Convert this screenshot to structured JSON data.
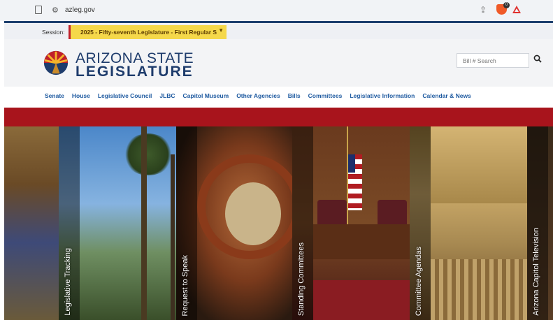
{
  "browser": {
    "url": "azleg.gov",
    "icons": [
      "bookmark-icon",
      "site-settings-icon",
      "share-icon",
      "brave-shield-icon",
      "rewards-icon"
    ],
    "shield_badge": "0"
  },
  "session": {
    "label": "Session:",
    "selected": "2025 - Fifty-seventh Legislature - First Regular S"
  },
  "header": {
    "title_line1": "ARIZONA STATE",
    "title_line2": "LEGISLATURE",
    "search_placeholder": "Bill # Search"
  },
  "nav": {
    "items": [
      "Senate",
      "House",
      "Legislative Council",
      "JLBC",
      "Capitol Museum",
      "Other Agencies",
      "Bills",
      "Committees",
      "Legislative Information",
      "Calendar & News"
    ]
  },
  "tiles": [
    {
      "label": ""
    },
    {
      "label": "Legislative Tracking"
    },
    {
      "label": "Request to Speak"
    },
    {
      "label": "Standing Committees"
    },
    {
      "label": "Committee Agendas"
    },
    {
      "label": "Arizona Capitol Television"
    }
  ],
  "colors": {
    "brand_navy": "#1e3c6c",
    "nav_link": "#1e5aa0",
    "red_band": "#a8141c",
    "session_yellow": "#f5d84a"
  }
}
